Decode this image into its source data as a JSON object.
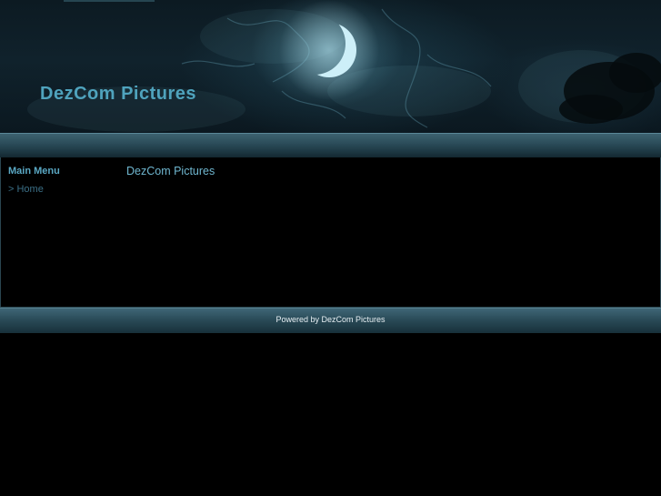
{
  "header": {
    "site_title": "DezCom Pictures"
  },
  "sidebar": {
    "heading": "Main Menu",
    "items": [
      {
        "label": "> Home"
      }
    ]
  },
  "main": {
    "heading": "DezCom Pictures"
  },
  "footer": {
    "text": "Powered by DezCom Pictures"
  },
  "colors": {
    "title": "#4fa3bd",
    "menu_heading": "#5aa8c4",
    "menu_link": "#3b6f86",
    "background": "#000000",
    "band": "#2b4c59"
  },
  "icons": {
    "banner_art": "crescent-moon-storm-clouds-image"
  }
}
